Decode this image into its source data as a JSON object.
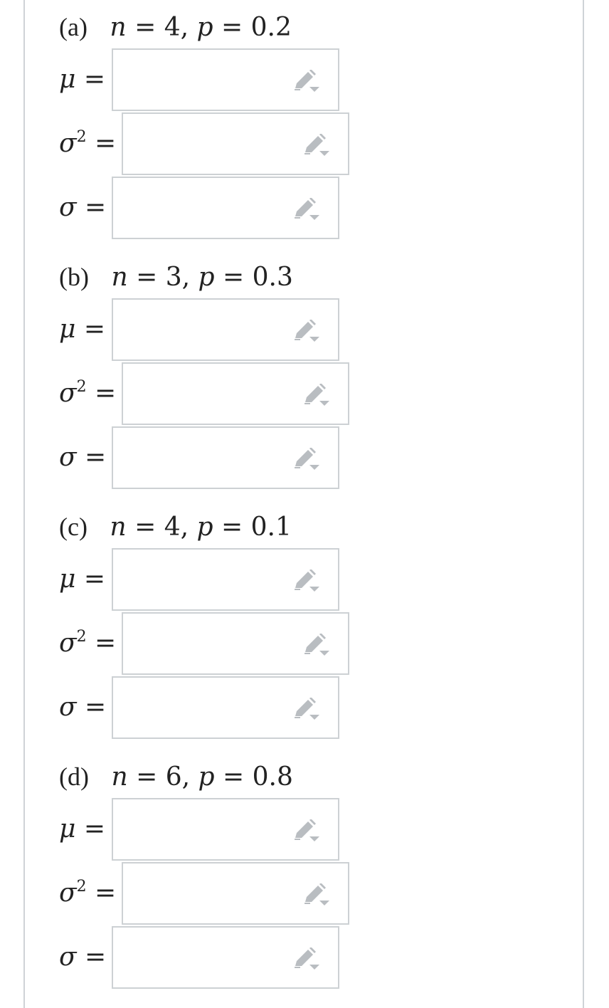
{
  "parts": [
    {
      "label": "(a)",
      "n_var": "n",
      "n_value": "4,",
      "p_var": "p",
      "p_value": "0.2",
      "fields": [
        {
          "symbol": "μ",
          "sup": "",
          "value": ""
        },
        {
          "symbol": "σ",
          "sup": "2",
          "value": ""
        },
        {
          "symbol": "σ",
          "sup": "",
          "value": ""
        }
      ]
    },
    {
      "label": "(b)",
      "n_var": "n",
      "n_value": "3,",
      "p_var": "p",
      "p_value": "0.3",
      "fields": [
        {
          "symbol": "μ",
          "sup": "",
          "value": ""
        },
        {
          "symbol": "σ",
          "sup": "2",
          "value": ""
        },
        {
          "symbol": "σ",
          "sup": "",
          "value": ""
        }
      ]
    },
    {
      "label": "(c)",
      "n_var": "n",
      "n_value": "4,",
      "p_var": "p",
      "p_value": "0.1",
      "fields": [
        {
          "symbol": "μ",
          "sup": "",
          "value": ""
        },
        {
          "symbol": "σ",
          "sup": "2",
          "value": ""
        },
        {
          "symbol": "σ",
          "sup": "",
          "value": ""
        }
      ]
    },
    {
      "label": "(d)",
      "n_var": "n",
      "n_value": "6,",
      "p_var": "p",
      "p_value": "0.8",
      "fields": [
        {
          "symbol": "μ",
          "sup": "",
          "value": ""
        },
        {
          "symbol": "σ",
          "sup": "2",
          "value": ""
        },
        {
          "symbol": "σ",
          "sup": "",
          "value": ""
        }
      ]
    }
  ],
  "equals_sign": "=",
  "icons": {
    "field_action": "pencil-dropdown-icon"
  },
  "colors": {
    "border": "#cdd1d4",
    "icon": "#b9bdc1",
    "text": "#222222"
  }
}
